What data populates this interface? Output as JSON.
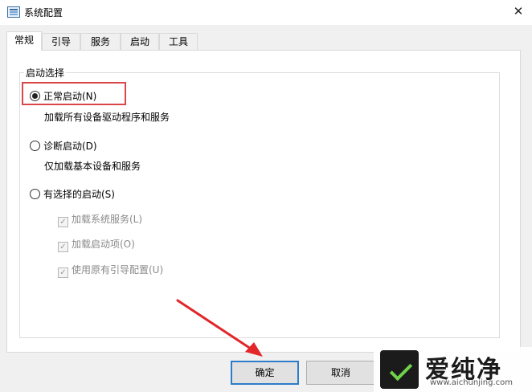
{
  "window": {
    "title": "系统配置",
    "close_glyph": "✕"
  },
  "tabs": [
    {
      "label": "常规",
      "active": true
    },
    {
      "label": "引导"
    },
    {
      "label": "服务"
    },
    {
      "label": "启动"
    },
    {
      "label": "工具"
    }
  ],
  "startup_group": {
    "label": "启动选择",
    "options": [
      {
        "label": "正常启动(N)",
        "selected": true,
        "description": "加载所有设备驱动程序和服务"
      },
      {
        "label": "诊断启动(D)",
        "selected": false,
        "description": "仅加载基本设备和服务"
      },
      {
        "label": "有选择的启动(S)",
        "selected": false
      }
    ],
    "selective_items": [
      {
        "label": "加载系统服务(L)",
        "checked": true,
        "enabled": false
      },
      {
        "label": "加载启动项(O)",
        "checked": true,
        "enabled": false
      },
      {
        "label": "使用原有引导配置(U)",
        "checked": true,
        "enabled": false
      }
    ]
  },
  "buttons": {
    "ok": "确定",
    "cancel": "取消"
  },
  "watermark": {
    "text": "爱纯净",
    "url": "www.aichunjing.com"
  },
  "colors": {
    "highlight_box": "#d9474a",
    "arrow": "#e2262a",
    "ok_border": "#2d7cc9",
    "logo_green": "#6fd34a"
  }
}
